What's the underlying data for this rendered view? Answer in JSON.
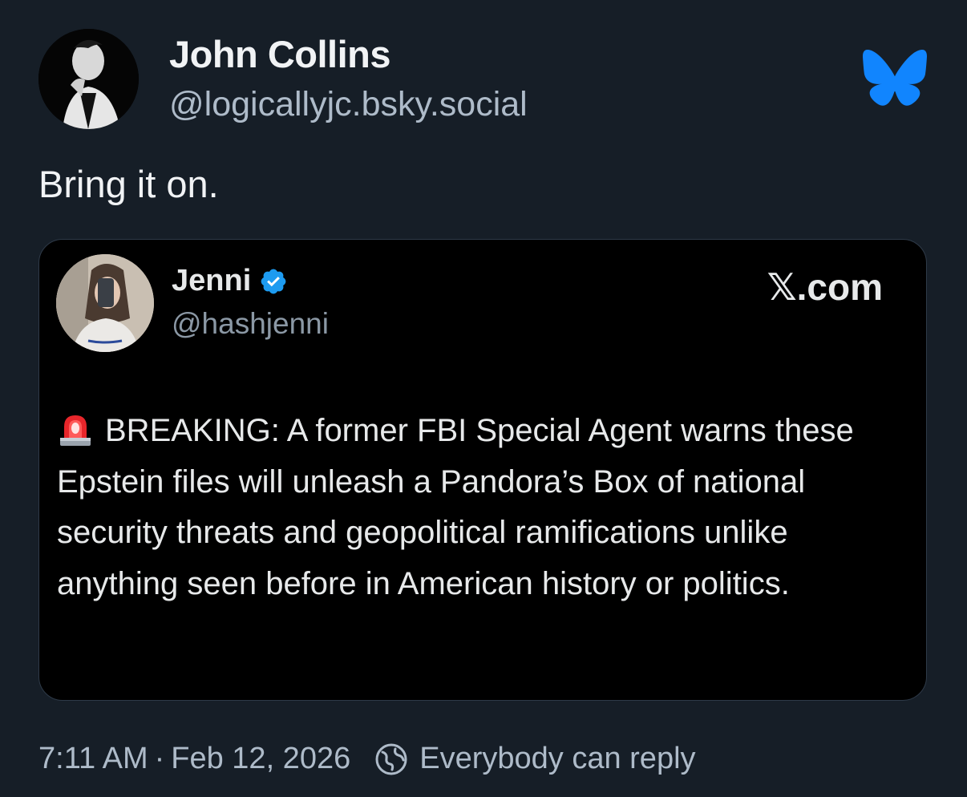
{
  "post": {
    "author": {
      "display_name": "John Collins",
      "handle": "@logicallyjc.bsky.social",
      "avatar_icon": "profile-photo"
    },
    "text": "Bring it on.",
    "brand_icon": "bluesky-butterfly-icon",
    "brand_color": "#1185fe"
  },
  "embed": {
    "author": {
      "display_name": "Jenni",
      "handle": "@hashjenni",
      "verified": true,
      "verified_color": "#1d9bf0"
    },
    "source_glyph": "𝕏",
    "source_label": ".com",
    "text_icon": "police-siren-emoji",
    "text": "BREAKING: A former FBI Special Agent warns these Epstein files will unleash a Pandora’s Box of national security threats and geopolitical ramifications unlike anything seen before in American history or politics."
  },
  "footer": {
    "time": "7:11 AM",
    "separator": "·",
    "date": "Feb 12, 2026",
    "reply_icon": "globe-icon",
    "reply_setting": "Everybody can reply"
  },
  "colors": {
    "background": "#161e27",
    "card_background": "#000000",
    "primary_text": "#f1f3f5",
    "secondary_text": "#aebbc9"
  }
}
